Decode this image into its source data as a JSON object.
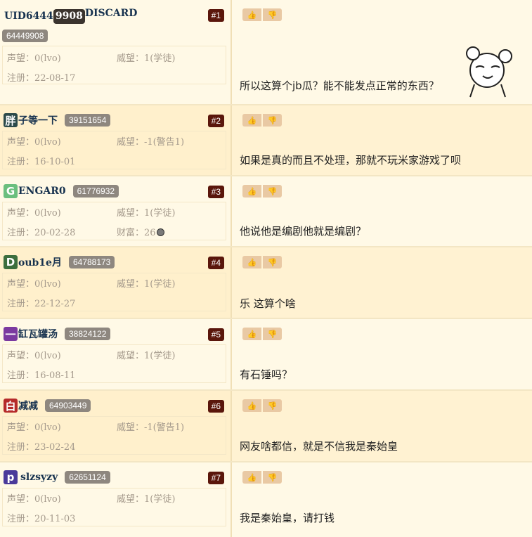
{
  "posts": [
    {
      "floor": "#1",
      "avatar_char": "",
      "avatar_color": "",
      "name": "UID6444",
      "uid_badge_text": "9908",
      "name_suffix": "DISCARD",
      "uid": "64449908",
      "shengwang": "0(lvo)",
      "weiwang": "1(学徒)",
      "register": "22-08-17",
      "extra": "",
      "content": "所以这算个jb瓜？能不能发点正常的东西？",
      "has_sticker": true
    },
    {
      "floor": "#2",
      "avatar_char": "胖",
      "avatar_color": "#2c4a4a",
      "name": "子等一下",
      "uid": "39151654",
      "shengwang": "0(lvo)",
      "weiwang": "-1(警告1)",
      "register": "16-10-01",
      "content": "如果是真的而且不处理，那就不玩米家游戏了呗"
    },
    {
      "floor": "#3",
      "avatar_char": "G",
      "avatar_color": "#6bbf7e",
      "name": "ENGAR0",
      "uid": "61776932",
      "shengwang": "0(lvo)",
      "weiwang": "1(学徒)",
      "register": "20-02-28",
      "extra_label": "财富：",
      "extra_value": "26",
      "content": "他说他是编剧他就是编剧？"
    },
    {
      "floor": "#4",
      "avatar_char": "D",
      "avatar_color": "#3c6e3e",
      "name": "oub1e月",
      "uid": "64788173",
      "shengwang": "0(lvo)",
      "weiwang": "1(学徒)",
      "register": "22-12-27",
      "content": "乐 这算个啥"
    },
    {
      "floor": "#5",
      "avatar_char": "一",
      "avatar_color": "#7b3aa0",
      "name": "缸瓦罐汤",
      "uid": "38824122",
      "shengwang": "0(lvo)",
      "weiwang": "1(学徒)",
      "register": "16-08-11",
      "content": "有石锤吗？"
    },
    {
      "floor": "#6",
      "avatar_char": "白",
      "avatar_color": "#b52a2a",
      "name": "减减",
      "uid": "64903449",
      "shengwang": "0(lvo)",
      "weiwang": "-1(警告1)",
      "register": "23-02-24",
      "content": "网友啥都信，就是不信我是秦始皇"
    },
    {
      "floor": "#7",
      "avatar_char": "p",
      "avatar_color": "#4a3a9a",
      "name": "slzsyzy",
      "uid": "62651124",
      "shengwang": "0(lvo)",
      "weiwang": "1(学徒)",
      "register": "20-11-03",
      "content": "我是秦始皇，请打钱"
    }
  ],
  "labels": {
    "shengwang": "声望：",
    "weiwang": "威望：",
    "register": "注册："
  },
  "icons": {
    "like": "thumbs-up-icon",
    "dislike": "thumbs-down-icon"
  }
}
